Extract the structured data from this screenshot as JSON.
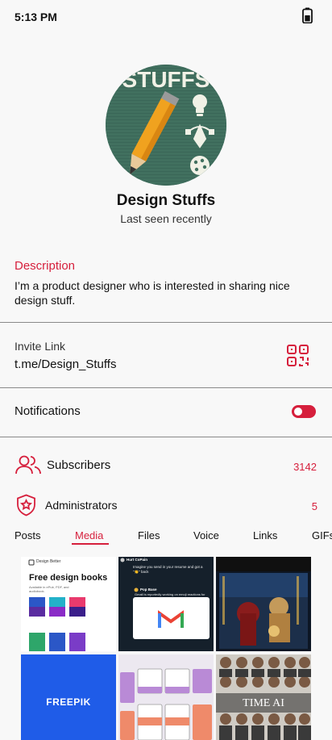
{
  "status_bar": {
    "time": "5:13 PM",
    "battery_icon": "battery-icon"
  },
  "profile": {
    "name": "Design Stuffs",
    "status": "Last seen recently",
    "avatar_text": "STUFFS"
  },
  "description": {
    "label": "Description",
    "text": "I’m a product designer who is interested in sharing nice design stuff."
  },
  "invite": {
    "label": "Invite Link",
    "link": "t.me/Design_Stuffs",
    "icon": "qr-code-icon"
  },
  "notifications": {
    "label": "Notifications",
    "enabled": true
  },
  "subscribers": {
    "label": "Subscribers",
    "count": "3142",
    "icon": "users-icon"
  },
  "administrators": {
    "label": "Administrators",
    "count": "5",
    "icon": "shield-star-icon"
  },
  "tabs": [
    {
      "label": "Posts",
      "active": false
    },
    {
      "label": "Media",
      "active": true
    },
    {
      "label": "Files",
      "active": false
    },
    {
      "label": "Voice",
      "active": false
    },
    {
      "label": "Links",
      "active": false
    },
    {
      "label": "GIFs",
      "active": false
    }
  ],
  "media": {
    "book_brand": "Design Better",
    "book_title": "Free design books",
    "book_subtitle": "Available in ePub, PDF, and audiobook.",
    "tweet_author": "Hurt CoPain",
    "tweet_text": "Imagine you send in your resume and got a \"👏\" back",
    "quote_author": "Pop Base",
    "quote_text": "Gmail is reportedly working on emoji reactions for emails.",
    "freepik_logo": "FREEPIK",
    "time_logo": "TIME AI"
  },
  "colors": {
    "accent": "#d61f3c",
    "background": "#f8f8f8",
    "divider": "#8a8a8a"
  }
}
